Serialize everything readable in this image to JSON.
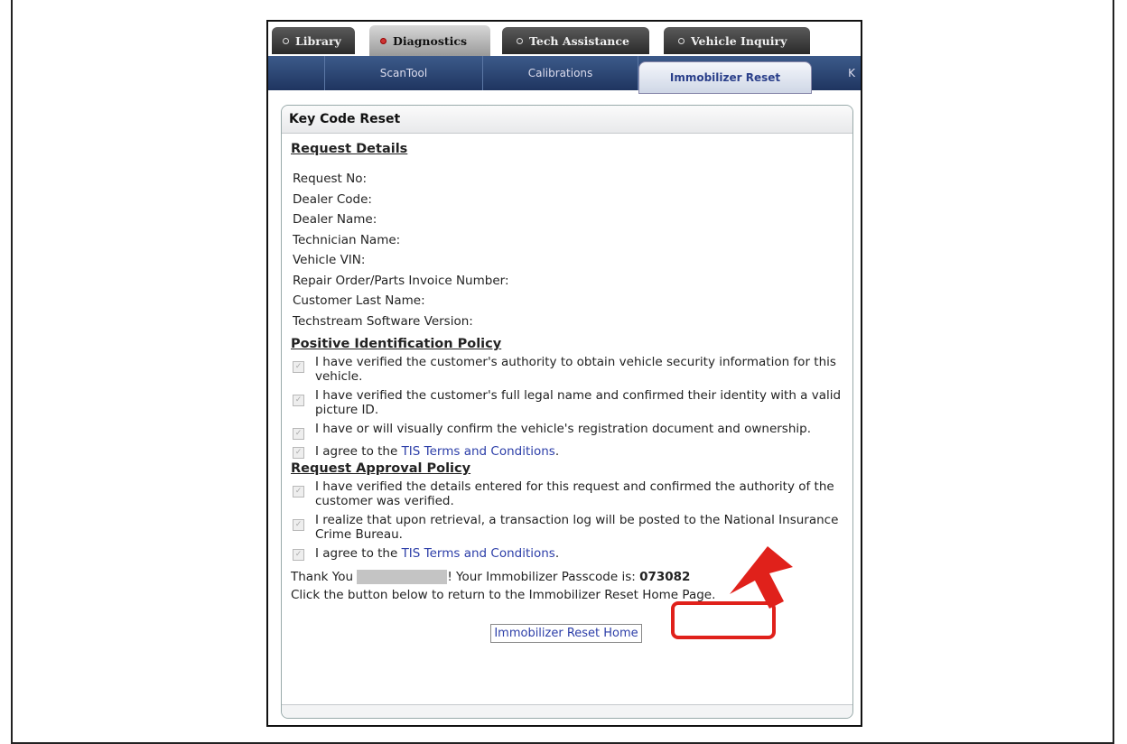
{
  "top_tabs": [
    {
      "label": "Library",
      "active": false
    },
    {
      "label": "Diagnostics",
      "active": true
    },
    {
      "label": "Tech Assistance",
      "active": false
    },
    {
      "label": "Vehicle Inquiry",
      "active": false
    }
  ],
  "sub_tabs": [
    {
      "label": "ScanTool"
    },
    {
      "label": "Calibrations"
    },
    {
      "label": "Immobilizer Reset"
    },
    {
      "label": "K"
    }
  ],
  "panel": {
    "title": "Key Code Reset"
  },
  "request_details": {
    "heading": "Request Details",
    "fields": [
      "Request No:",
      "Dealer Code:",
      "Dealer Name:",
      "Technician Name:",
      "Vehicle VIN:",
      "Repair Order/Parts Invoice Number:",
      "Customer Last Name:",
      "Techstream Software Version:"
    ]
  },
  "positive_id_policy": {
    "heading": "Positive Identification Policy",
    "items": [
      "I have verified the customer's authority to obtain vehicle security information for this vehicle.",
      "I have verified the customer's full legal name and confirmed their identity with a valid picture ID.",
      "I have or will visually confirm the vehicle's registration document and ownership."
    ],
    "agree_prefix": "I agree to the ",
    "agree_link": "TIS Terms and Conditions",
    "agree_suffix": "."
  },
  "request_approval_policy": {
    "heading": "Request Approval Policy",
    "items": [
      "I have verified the details entered for this request and confirmed the authority of the customer was verified.",
      "I realize that upon retrieval, a transaction log will be posted to the National Insurance Crime Bureau."
    ],
    "agree_prefix": "I agree to the ",
    "agree_link": "TIS Terms and Conditions",
    "agree_suffix": "."
  },
  "result": {
    "thanks_prefix": "Thank You ",
    "thanks_suffix": "! Your Immobilizer Passcode is: ",
    "passcode": "073082",
    "instruction": "Click the button below to return to the Immobilizer Reset Home Page."
  },
  "home_button": "Immobilizer Reset Home",
  "colors": {
    "highlight": "#e0211b",
    "link": "#2c3ea8",
    "subnav": "#1f3560"
  }
}
